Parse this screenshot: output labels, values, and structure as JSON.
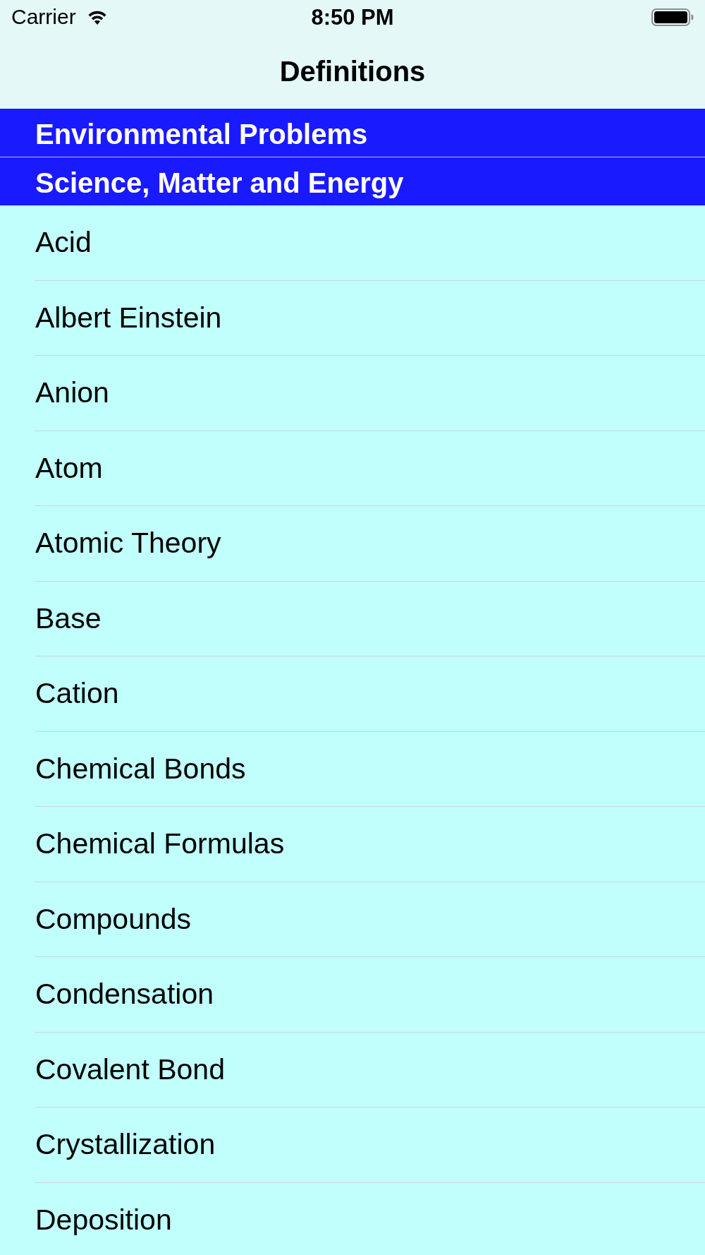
{
  "status_bar": {
    "carrier": "Carrier",
    "time": "8:50 PM"
  },
  "nav_bar": {
    "title": "Definitions"
  },
  "sections": [
    {
      "title": "Environmental Problems"
    },
    {
      "title": "Science, Matter and Energy",
      "rows": [
        "Acid",
        "Albert Einstein",
        "Anion",
        "Atom",
        "Atomic Theory",
        "Base",
        "Cation",
        "Chemical Bonds",
        "Chemical Formulas",
        "Compounds",
        "Condensation",
        "Covalent Bond",
        "Crystallization",
        "Deposition"
      ]
    }
  ]
}
